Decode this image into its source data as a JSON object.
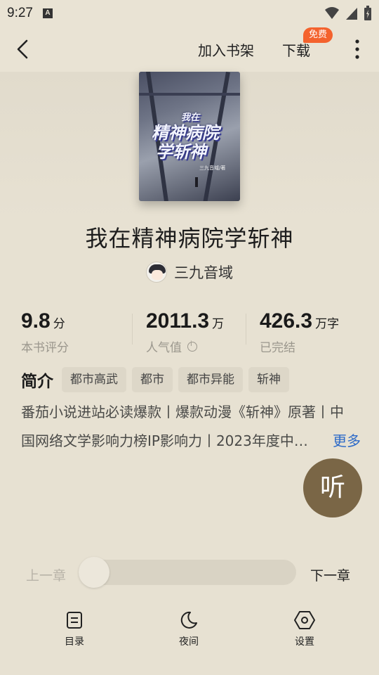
{
  "status_bar": {
    "time": "9:27",
    "notification_icon": "A"
  },
  "top_bar": {
    "add_to_shelf": "加入书架",
    "download": "下载",
    "free_badge": "免费"
  },
  "book": {
    "cover_title_small": "我在",
    "cover_title_line1": "精神病院",
    "cover_title_line2": "学斩神",
    "cover_author": "三九音域/著",
    "title": "我在精神病院学斩神",
    "author": "三九音域"
  },
  "stats": [
    {
      "value": "9.8",
      "unit": "分",
      "label": "本书评分"
    },
    {
      "value": "2011.3",
      "unit": "万",
      "label": "人气值"
    },
    {
      "value": "426.3",
      "unit": "万字",
      "label": "已完结"
    }
  ],
  "intro": {
    "label": "简介",
    "tags": [
      "都市高武",
      "都市",
      "都市异能",
      "斩神"
    ],
    "line1": "番茄小说进站必读爆款丨爆款动漫《斩神》原著丨中",
    "line2": "国网络文学影响力榜IP影响力丨2023年度中…",
    "more": "更多"
  },
  "listen_button": "听",
  "chapter_nav": {
    "prev": "上一章",
    "next": "下一章",
    "progress": 0
  },
  "bottom_nav": [
    {
      "label": "目录",
      "icon": "toc-icon"
    },
    {
      "label": "夜间",
      "icon": "moon-icon"
    },
    {
      "label": "设置",
      "icon": "settings-icon"
    }
  ],
  "colors": {
    "background": "#e7e1d2",
    "listen_button": "#7a6646",
    "free_badge": "#f4622d",
    "more_link": "#2d6ac8"
  }
}
